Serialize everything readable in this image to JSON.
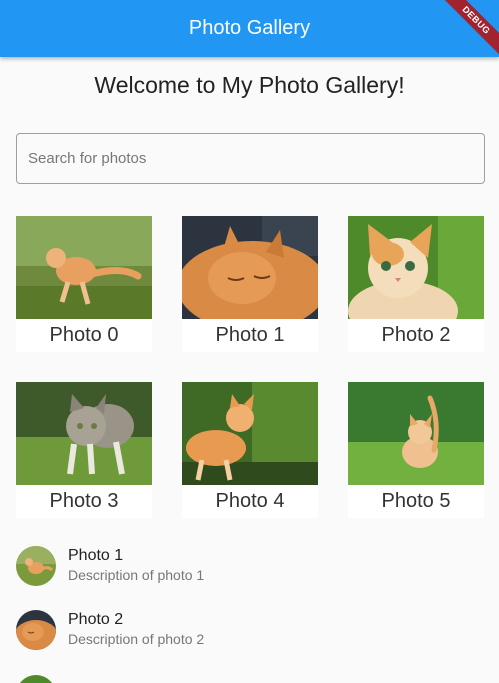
{
  "appbar": {
    "title": "Photo Gallery",
    "debug_label": "DEBUG"
  },
  "welcome": "Welcome to My Photo Gallery!",
  "search": {
    "placeholder": "Search for photos",
    "value": ""
  },
  "grid": [
    {
      "caption": "Photo 0"
    },
    {
      "caption": "Photo 1"
    },
    {
      "caption": "Photo 2"
    },
    {
      "caption": "Photo 3"
    },
    {
      "caption": "Photo 4"
    },
    {
      "caption": "Photo 5"
    }
  ],
  "list": [
    {
      "title": "Photo 1",
      "subtitle": "Description of photo 1"
    },
    {
      "title": "Photo 2",
      "subtitle": "Description of photo 2"
    }
  ],
  "colors": {
    "primary": "#2196f3",
    "debug": "#a0232f",
    "background": "#fafafa"
  }
}
